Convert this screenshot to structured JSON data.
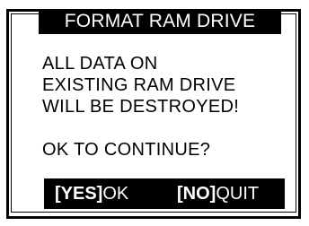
{
  "dialog": {
    "title": "FORMAT RAM DRIVE",
    "message_lines": [
      "ALL DATA ON",
      "EXISTING RAM DRIVE",
      "WILL BE DESTROYED!"
    ],
    "prompt": "OK TO CONTINUE?",
    "actions": [
      {
        "key": "[YES]",
        "label": "OK"
      },
      {
        "key": "[NO]",
        "label": "QUIT"
      }
    ]
  },
  "colors": {
    "background": "#ffffff",
    "foreground": "#000000",
    "inverse_text": "#ffffff"
  }
}
